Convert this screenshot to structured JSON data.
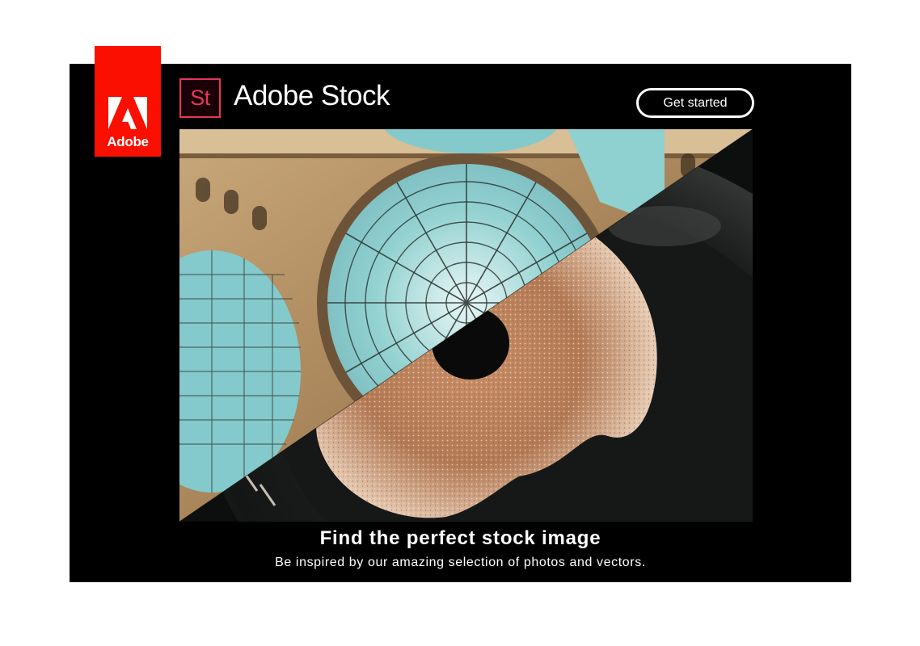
{
  "brand": {
    "company_word": "Adobe",
    "logo_icon": "adobe-a-icon",
    "badge_text": "St",
    "product_name": "Adobe Stock",
    "colors": {
      "adobe_red": "#fa0f00",
      "stock_pink": "#e8365d",
      "banner_bg": "#000000",
      "text": "#ffffff"
    }
  },
  "cta": {
    "label": "Get started"
  },
  "hero": {
    "icon": "stock-photo-collage-image"
  },
  "copy": {
    "headline": "Find the perfect stock image",
    "subline": "Be inspired by our amazing selection of photos and vectors."
  }
}
